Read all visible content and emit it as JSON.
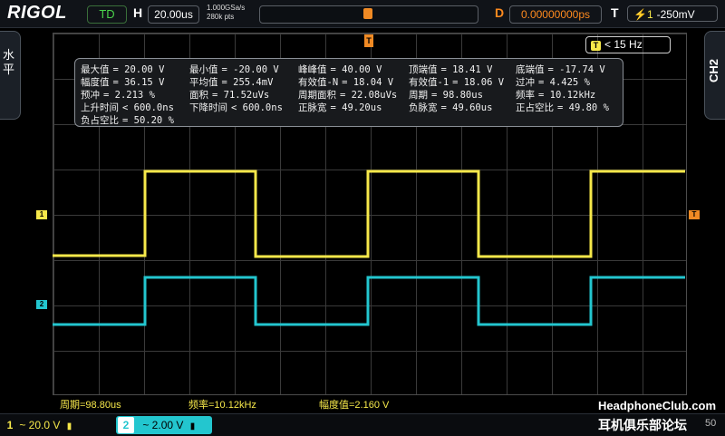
{
  "topbar": {
    "logo": "RIGOL",
    "mode": "TD",
    "h_label": "H",
    "timebase": "20.00us",
    "sample_rate": "1.000GSa/s",
    "memory_depth": "280k pts",
    "d_label": "D",
    "delay": "0.00000000ps",
    "t_label": "T",
    "trigger_level": "-250mV"
  },
  "side": {
    "left_tab": "水平",
    "right_tab": "CH2"
  },
  "freq_badge": "< 15 Hz",
  "measurements": {
    "rows": [
      [
        {
          "k": "最大值",
          "v": "= 20.00 V"
        },
        {
          "k": "最小值",
          "v": "= -20.00 V"
        },
        {
          "k": "峰峰值",
          "v": "= 40.00 V"
        },
        {
          "k": "顶端值",
          "v": "= 18.41 V"
        },
        {
          "k": "底端值",
          "v": "= -17.74 V"
        }
      ],
      [
        {
          "k": "幅度值",
          "v": "= 36.15 V"
        },
        {
          "k": "平均值",
          "v": "= 255.4mV"
        },
        {
          "k": "有效值-N",
          "v": "= 18.04 V"
        },
        {
          "k": "有效值-1",
          "v": "= 18.06 V"
        },
        {
          "k": "过冲",
          "v": "= 4.425 %"
        }
      ],
      [
        {
          "k": "预冲",
          "v": "= 2.213 %"
        },
        {
          "k": "面积",
          "v": "= 71.52uVs"
        },
        {
          "k": "周期面积",
          "v": "= 22.08uVs"
        },
        {
          "k": "周期",
          "v": "= 98.80us"
        },
        {
          "k": "频率",
          "v": "= 10.12kHz"
        }
      ],
      [
        {
          "k": "上升时间",
          "v": "< 600.0ns"
        },
        {
          "k": "下降时间",
          "v": "< 600.0ns"
        },
        {
          "k": "正脉宽",
          "v": "= 49.20us"
        },
        {
          "k": "负脉宽",
          "v": "= 49.60us"
        },
        {
          "k": "正占空比",
          "v": "= 49.80 %"
        }
      ],
      [
        {
          "k": "负占空比",
          "v": "= 50.20 %"
        }
      ]
    ]
  },
  "markers": {
    "ch1": "1",
    "ch2": "2",
    "trigger": "T"
  },
  "bottom_measurements": [
    "周期=98.80us",
    "频率=10.12kHz",
    "幅度值=2.160 V"
  ],
  "footer": {
    "ch1_num": "1",
    "ch1_value": "~ 20.0 V",
    "ch2_num": "2",
    "ch2_value": "~ 2.00 V",
    "hidden_num": "50"
  },
  "watermark": {
    "site": "HeadphoneClub.com",
    "cn": "耳机俱乐部论坛"
  },
  "colors": {
    "ch1": "#f6e84a",
    "ch2": "#23c6cf",
    "trigger": "#f08a24"
  }
}
